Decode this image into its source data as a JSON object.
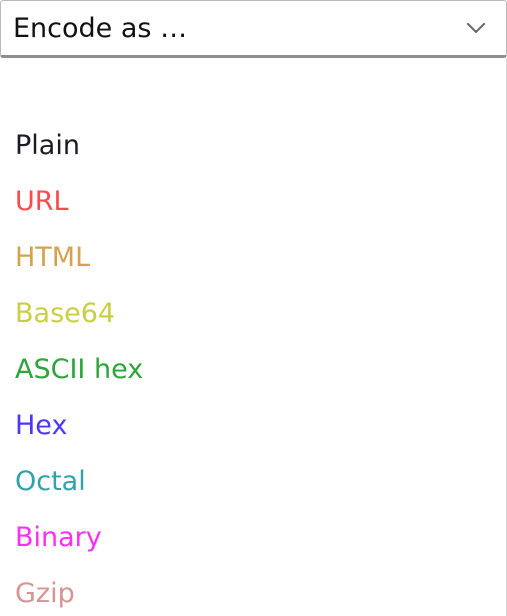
{
  "dropdown": {
    "label": "Encode as …",
    "icon": "chevron-down-icon"
  },
  "options": [
    {
      "label": "Plain",
      "color": "#1b1b24"
    },
    {
      "label": "URL",
      "color": "#ff4a4a"
    },
    {
      "label": "HTML",
      "color": "#d5a24f"
    },
    {
      "label": "Base64",
      "color": "#c9cf45"
    },
    {
      "label": "ASCII hex",
      "color": "#2ca63b"
    },
    {
      "label": "Hex",
      "color": "#4b37ff"
    },
    {
      "label": "Octal",
      "color": "#2fa3a9"
    },
    {
      "label": "Binary",
      "color": "#ff2ef5"
    },
    {
      "label": "Gzip",
      "color": "#d69595"
    }
  ]
}
